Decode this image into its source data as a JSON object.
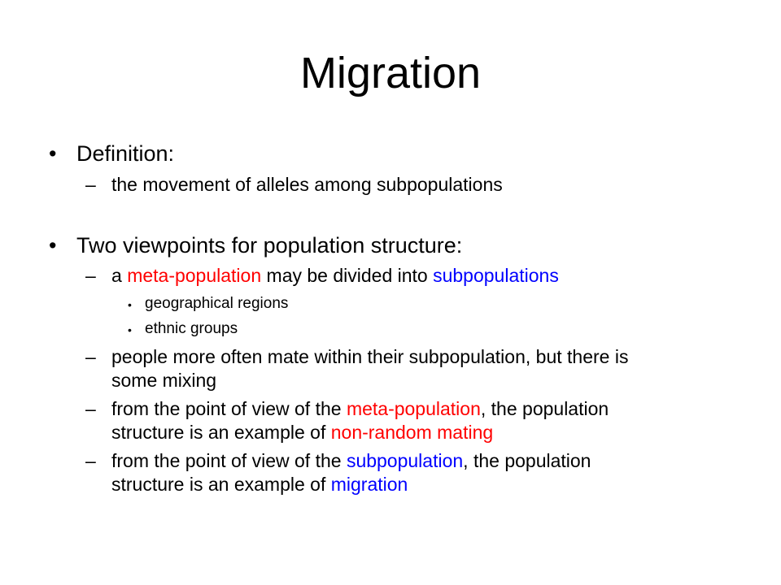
{
  "slide": {
    "title": "Migration",
    "section1": {
      "bullet": "•",
      "heading": "Definition:",
      "dash": "–",
      "definition": "the movement of alleles among subpopulations"
    },
    "section2": {
      "bullet": "•",
      "heading": "Two viewpoints for population structure:",
      "dash": "–",
      "sub_bullet": "•",
      "point1": {
        "a": "a ",
        "meta": "meta-population",
        "mid": " may be divided into ",
        "sub": "subpopulations"
      },
      "examples": [
        "geographical regions",
        "ethnic groups"
      ],
      "point2": {
        "line1": "people more often mate within their subpopulation, but there is",
        "line2": "some mixing"
      },
      "point3": {
        "pre": "from the point of view of the ",
        "meta": "meta-population",
        "post": ", the population",
        "line2_pre": "structure is an example of ",
        "nonrandom": "non-random mating"
      },
      "point4": {
        "pre": "from the point of view of the ",
        "sub": "subpopulation",
        "post": ", the population",
        "line2_pre": "structure is an example of ",
        "migration": "migration"
      }
    }
  },
  "colors": {
    "highlight_red": "#ff0000",
    "highlight_blue": "#0000ff"
  }
}
